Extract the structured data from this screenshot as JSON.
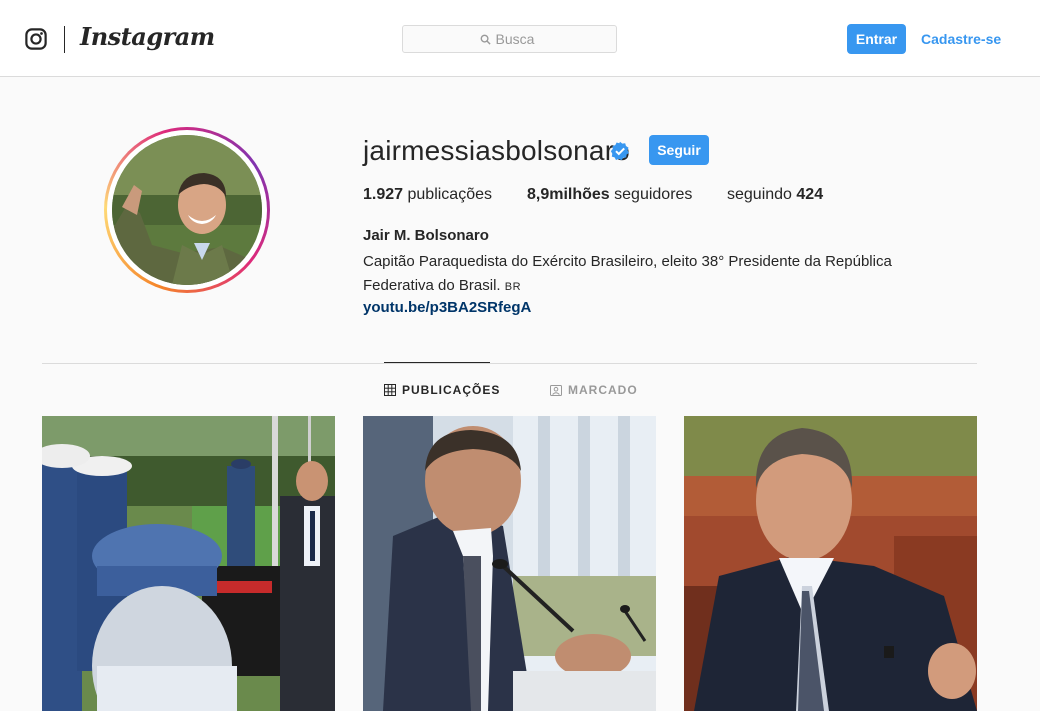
{
  "nav": {
    "brand": "Instagram",
    "search_placeholder": "Busca",
    "login_label": "Entrar",
    "signup_label": "Cadastre-se",
    "accent": "#3897f0"
  },
  "profile": {
    "username": "jairmessiasbolsonaro",
    "verified": true,
    "follow_label": "Seguir",
    "stats": {
      "posts_count": "1.927",
      "posts_label": "publicações",
      "followers_count": "8,9milhões",
      "followers_label": "seguidores",
      "following_label": "seguindo",
      "following_count": "424"
    },
    "full_name": "Jair M. Bolsonaro",
    "bio_line1": "Capitão Paraquedista do Exército Brasileiro, eleito 38° Presidente da República",
    "bio_line2": "Federativa do Brasil.",
    "bio_country": "BR",
    "link": "youtu.be/p3BA2SRfegA"
  },
  "tabs": [
    {
      "label": "PUBLICAÇÕES",
      "icon": "grid-icon",
      "active": true
    },
    {
      "label": "MARCADO",
      "icon": "tagged-icon",
      "active": false
    }
  ],
  "posts": [
    {
      "subject": "military-ceremony"
    },
    {
      "subject": "portrait-microphone"
    },
    {
      "subject": "portrait-suit"
    }
  ]
}
